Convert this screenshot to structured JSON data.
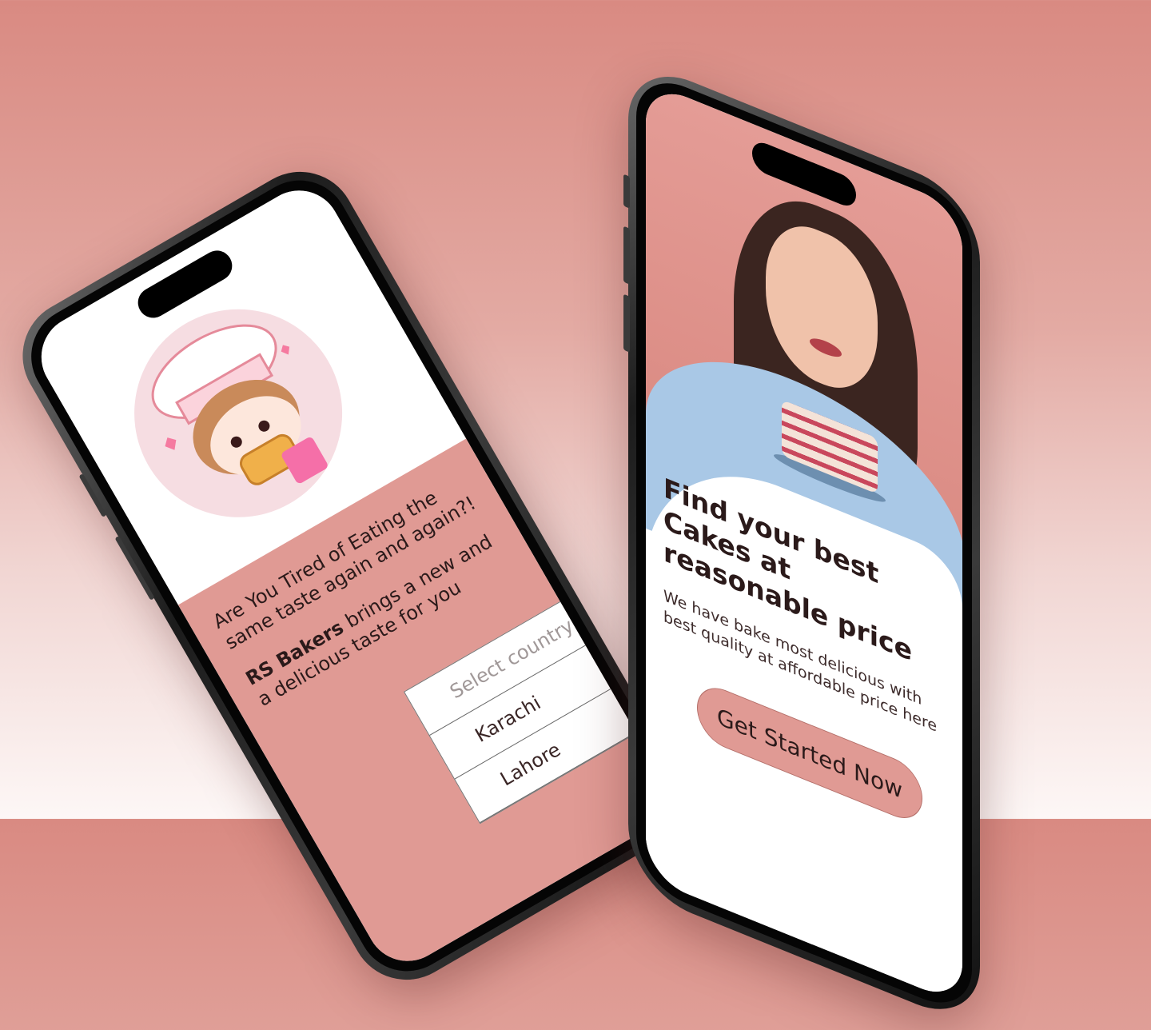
{
  "left_screen": {
    "headline": "Are You Tired of Eating the same taste again and again?!",
    "brand": "RS Bakers",
    "tagline": " brings a new and a delicious taste for you",
    "dropdown": {
      "placeholder": "Select country",
      "options": [
        "Karachi",
        "Lahore"
      ]
    },
    "colors": {
      "accent": "#e09a94"
    }
  },
  "right_screen": {
    "title": "Find your best Cakes at reasonable price",
    "description": "We have bake most delicious with best quality at affordable price here",
    "cta_label": "Get Started Now",
    "colors": {
      "accent": "#e09a94"
    }
  }
}
